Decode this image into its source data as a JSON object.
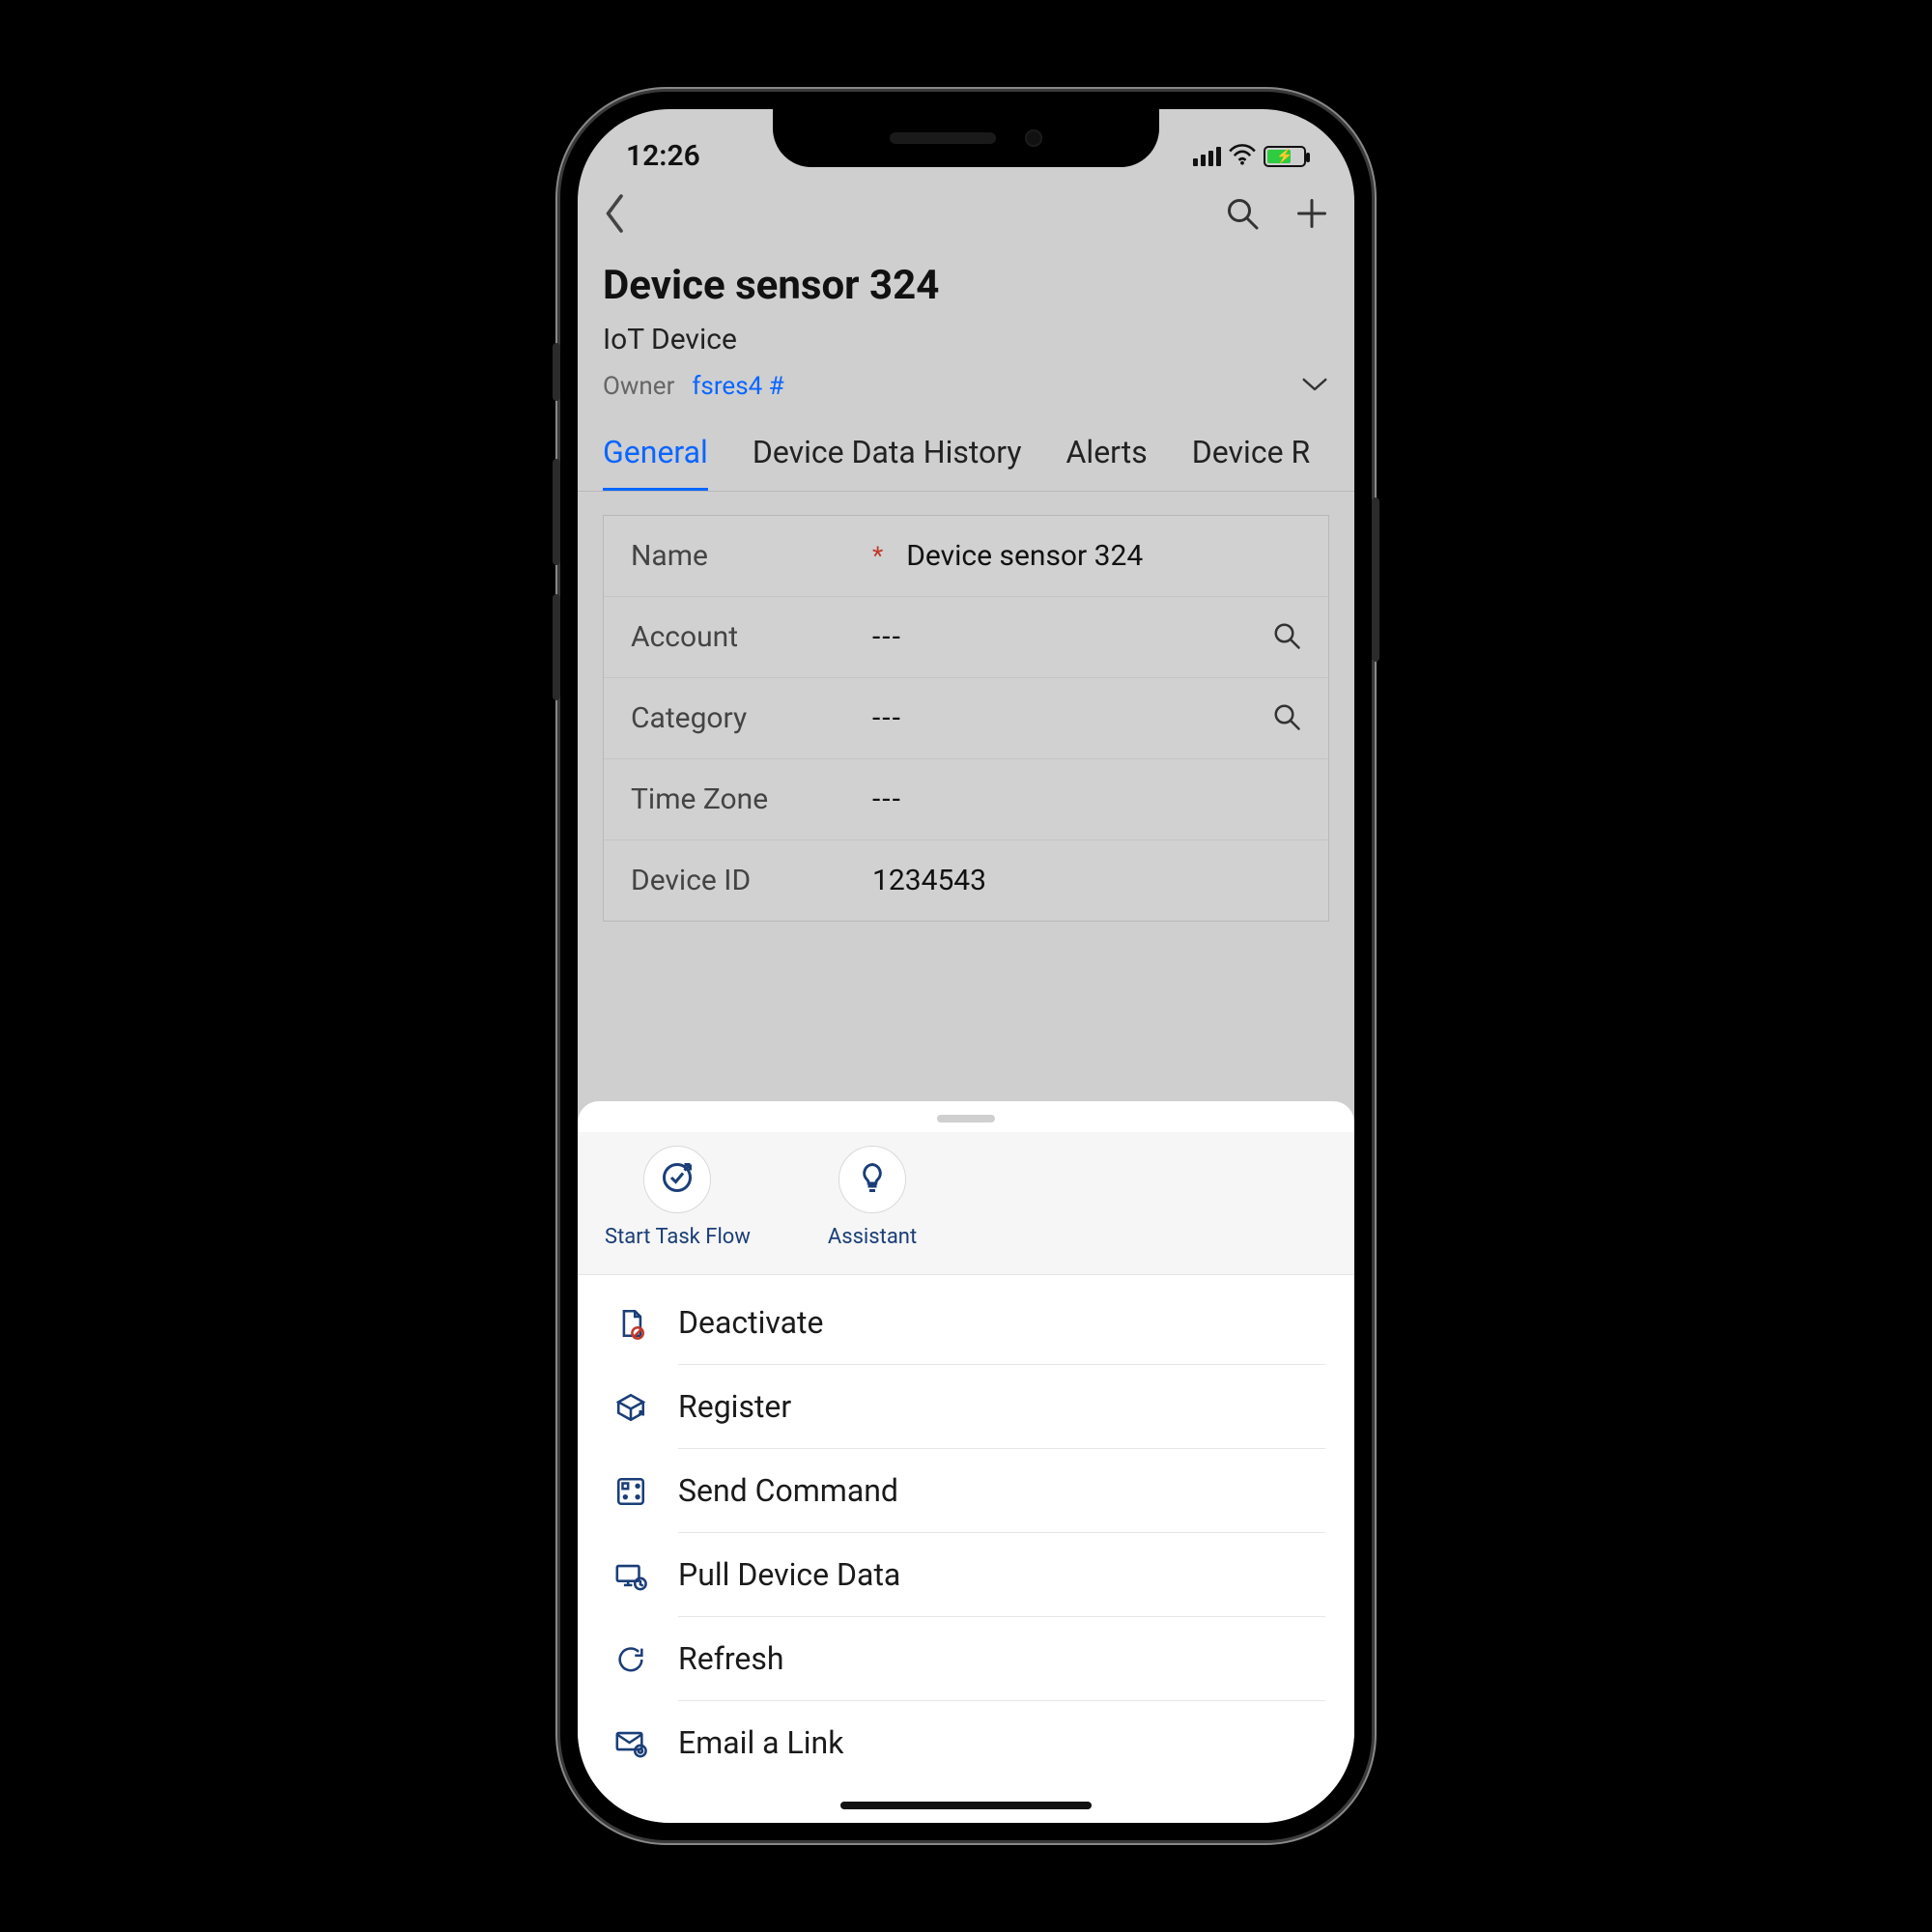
{
  "status": {
    "time": "12:26"
  },
  "header": {
    "title": "Device sensor 324",
    "subtitle": "IoT Device",
    "owner_label": "Owner",
    "owner_value": "fsres4 #"
  },
  "tabs": {
    "general": "General",
    "history": "Device Data History",
    "alerts": "Alerts",
    "reg": "Device R"
  },
  "fields": {
    "name_label": "Name",
    "name_value": "Device sensor 324",
    "account_label": "Account",
    "account_value": "---",
    "category_label": "Category",
    "category_value": "---",
    "tz_label": "Time Zone",
    "tz_value": "---",
    "deviceid_label": "Device ID",
    "deviceid_value": "1234543"
  },
  "sheet_top": {
    "task_flow": "Start Task Flow",
    "assistant": "Assistant"
  },
  "actions": {
    "deactivate": "Deactivate",
    "register": "Register",
    "send_command": "Send Command",
    "pull_data": "Pull Device Data",
    "refresh": "Refresh",
    "email_link": "Email a Link"
  }
}
